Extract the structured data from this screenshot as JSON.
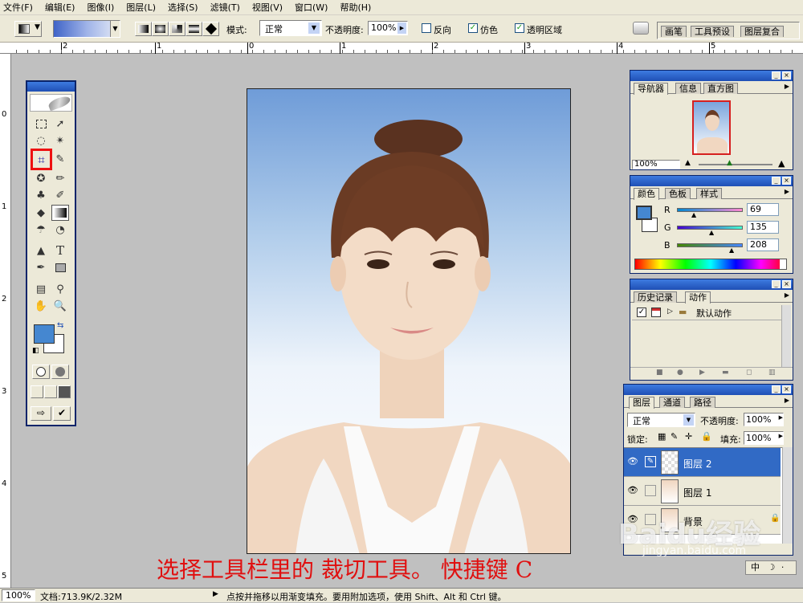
{
  "menu": [
    "文件(F)",
    "编辑(E)",
    "图像(I)",
    "图层(L)",
    "选择(S)",
    "滤镜(T)",
    "视图(V)",
    "窗口(W)",
    "帮助(H)"
  ],
  "options": {
    "mode_label": "模式:",
    "mode_value": "正常",
    "opacity_label": "不透明度:",
    "opacity_value": "100%",
    "reverse_label": "反向",
    "dither_label": "仿色",
    "transparency_label": "透明区域",
    "reverse_checked": false,
    "dither_checked": true,
    "transparency_checked": true
  },
  "palette_well_tabs": [
    "画笔",
    "工具预设",
    "图层复合"
  ],
  "ruler_h": [
    "2",
    "1",
    "0",
    "1",
    "2",
    "3",
    "4",
    "5"
  ],
  "ruler_v": [
    "0",
    "1",
    "2",
    "3",
    "4",
    "5"
  ],
  "navigator": {
    "tabs": [
      "导航器",
      "信息",
      "直方图"
    ],
    "zoom": "100%"
  },
  "color": {
    "tabs": [
      "颜色",
      "色板",
      "样式"
    ],
    "r_label": "R",
    "g_label": "G",
    "b_label": "B",
    "r": "69",
    "g": "135",
    "b": "208",
    "swatch": "#4587d0"
  },
  "history": {
    "tabs": [
      "历史记录",
      "动作"
    ],
    "item": "默认动作"
  },
  "layers": {
    "tabs": [
      "图层",
      "通道",
      "路径"
    ],
    "blend_mode": "正常",
    "opacity_label": "不透明度:",
    "opacity": "100%",
    "lock_label": "锁定:",
    "fill_label": "填充:",
    "fill": "100%",
    "rows": [
      {
        "name": "图层 2",
        "selected": true
      },
      {
        "name": "图层 1",
        "selected": false
      },
      {
        "name": "背景",
        "selected": false
      }
    ]
  },
  "status": {
    "zoom": "100%",
    "doc": "文档:713.9K/2.32M",
    "hint": "点按并拖移以用渐变填充。要用附加选项，使用 Shift、Alt 和 Ctrl 键。"
  },
  "caption": "选择工具栏里的 裁切工具。 快捷键 C",
  "watermark": {
    "brand": "Baidu经验",
    "url": "jingyan.baidu.com"
  },
  "ime": "中",
  "colors": {
    "foreground": "#4587d0",
    "background": "#ffffff",
    "highlight": "#316ac5",
    "caption": "#e01010"
  }
}
